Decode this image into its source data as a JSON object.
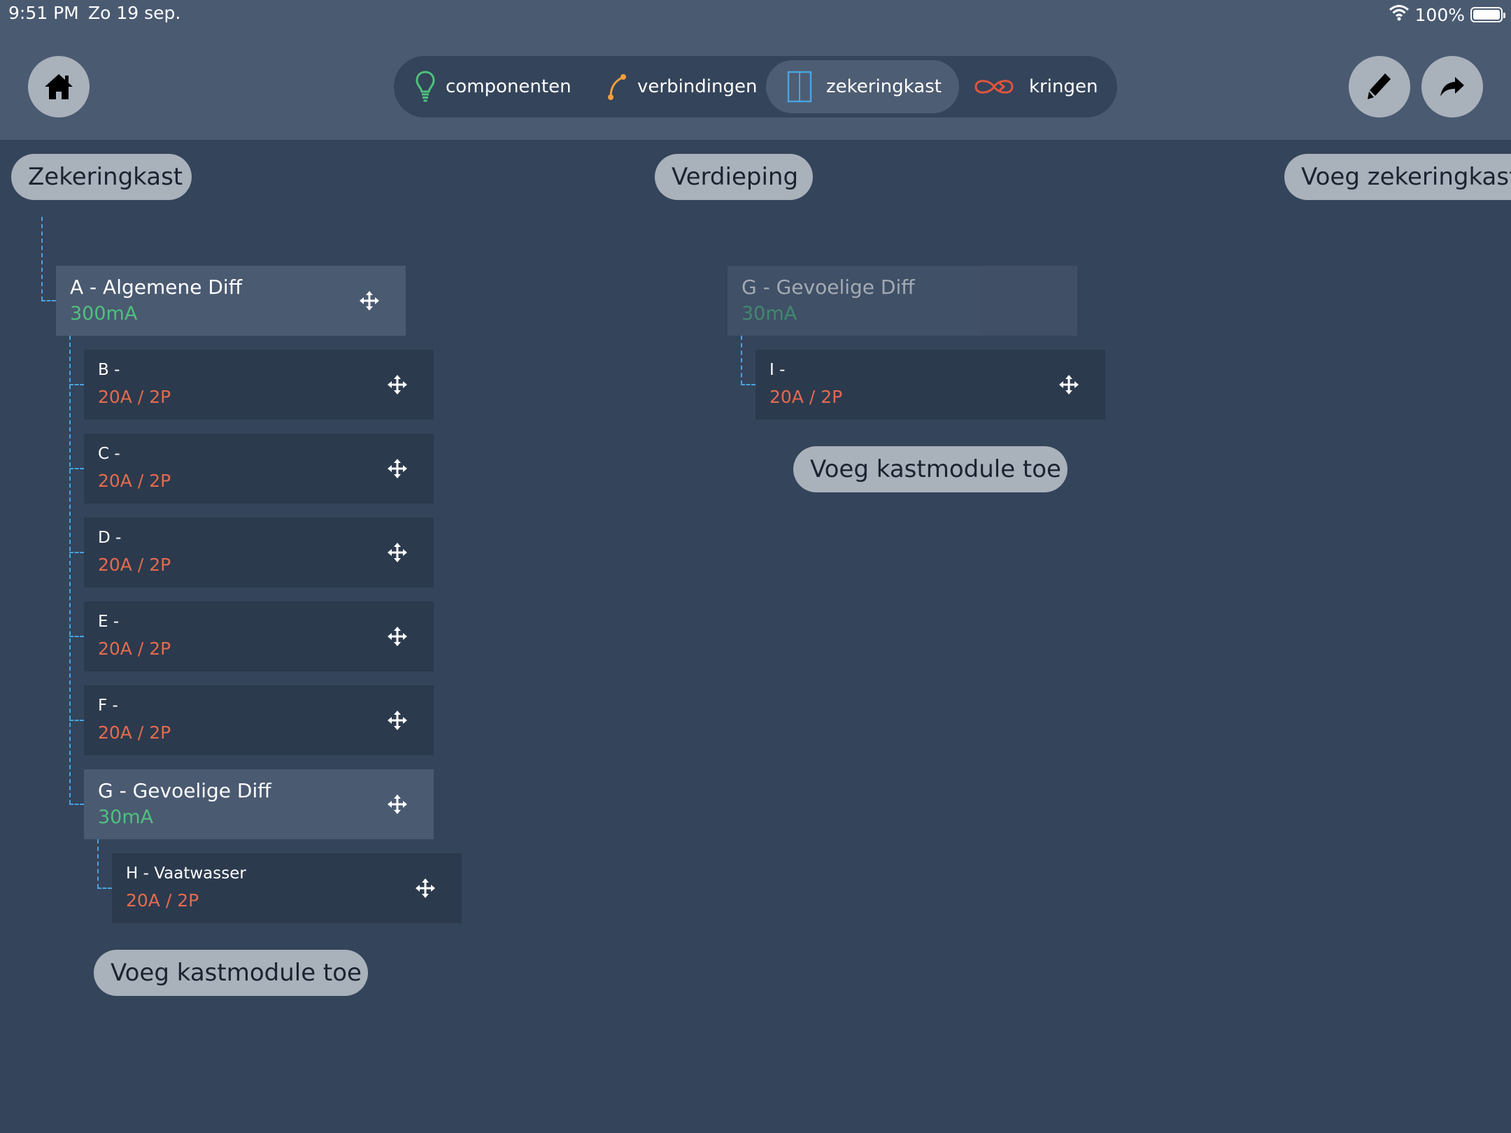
{
  "status_bar": {
    "time": "9:51 PM",
    "date": "Zo 19 sep.",
    "battery": "100%"
  },
  "header": {
    "home_icon": "home-icon",
    "edit_icon": "pencil-icon",
    "share_icon": "share-arrow-icon",
    "tabs": [
      {
        "label": "componenten",
        "icon": "lightbulb-icon",
        "active": false
      },
      {
        "label": "verbindingen",
        "icon": "connection-curve-icon",
        "active": false
      },
      {
        "label": "zekeringkast",
        "icon": "fusebox-icon",
        "active": true
      },
      {
        "label": "kringen",
        "icon": "infinity-loop-icon",
        "active": false
      }
    ]
  },
  "columns": {
    "left_header": "Zekeringkast",
    "middle_header": "Verdieping",
    "right_header": "Voeg zekeringkast"
  },
  "left_tree": {
    "root": {
      "title": "A - Algemene Diff",
      "rating": "300mA"
    },
    "modules": [
      {
        "title": "B -",
        "rating": "20A / 2P"
      },
      {
        "title": "C -",
        "rating": "20A / 2P"
      },
      {
        "title": "D -",
        "rating": "20A / 2P"
      },
      {
        "title": "E -",
        "rating": "20A / 2P"
      },
      {
        "title": "F -",
        "rating": "20A / 2P"
      }
    ],
    "sub_diff": {
      "title": "G - Gevoelige Diff",
      "rating": "30mA"
    },
    "sub_module": {
      "title": "H - Vaatwasser",
      "rating": "20A / 2P"
    },
    "add_button": "Voeg kastmodule toe"
  },
  "middle_tree": {
    "diff": {
      "title": "G - Gevoelige Diff",
      "rating": "30mA"
    },
    "module": {
      "title": "I -",
      "rating": "20A / 2P"
    },
    "add_button": "Voeg kastmodule toe"
  },
  "colors": {
    "background": "#34445a",
    "header": "#4a5a71",
    "diff_card": "#4a5a71",
    "module_card": "#2c3a4d",
    "diff_rating": "#4fc07e",
    "module_rating": "#e46b4f",
    "connector": "#4aa3df",
    "pill": "#a9b1bb"
  }
}
